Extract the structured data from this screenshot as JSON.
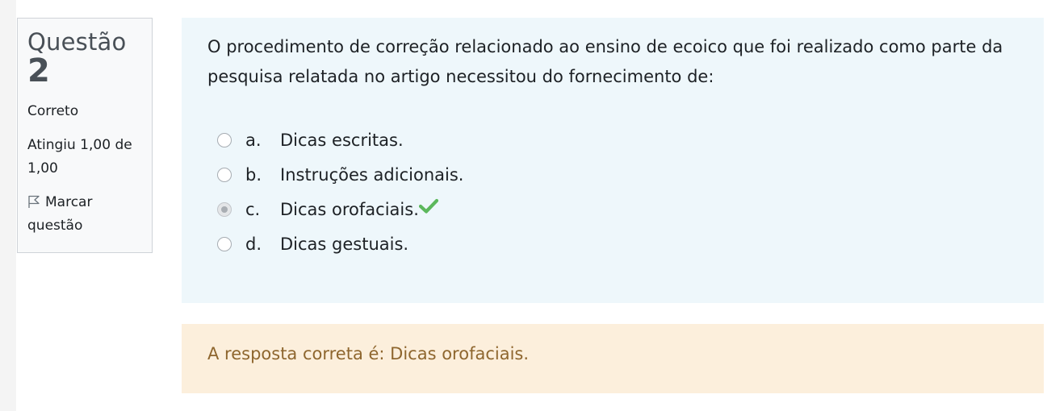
{
  "info": {
    "question_label": "Questão",
    "question_number": "2",
    "state": "Correto",
    "grade": "Atingiu 1,00 de 1,00",
    "flag_label": "Marcar questão"
  },
  "question": {
    "text": "O procedimento de correção relacionado ao ensino de ecoico que foi realizado como parte da pesquisa relatada no artigo necessitou do fornecimento de:",
    "answers": [
      {
        "letter": "a.",
        "text": "Dicas escritas.",
        "selected": false
      },
      {
        "letter": "b.",
        "text": "Instruções adicionais.",
        "selected": false
      },
      {
        "letter": "c.",
        "text": "Dicas orofaciais.",
        "selected": true,
        "correct": true
      },
      {
        "letter": "d.",
        "text": "Dicas gestuais.",
        "selected": false
      }
    ]
  },
  "feedback": {
    "right_answer": "A resposta correta é: Dicas orofaciais."
  },
  "icons": {
    "flag": "flag-icon",
    "correct": "checkmark-icon"
  },
  "colors": {
    "question_bg": "#eef7fb",
    "feedback_bg": "#fcefdc",
    "feedback_text": "#8e662e",
    "correct_check": "#5cb85c"
  }
}
